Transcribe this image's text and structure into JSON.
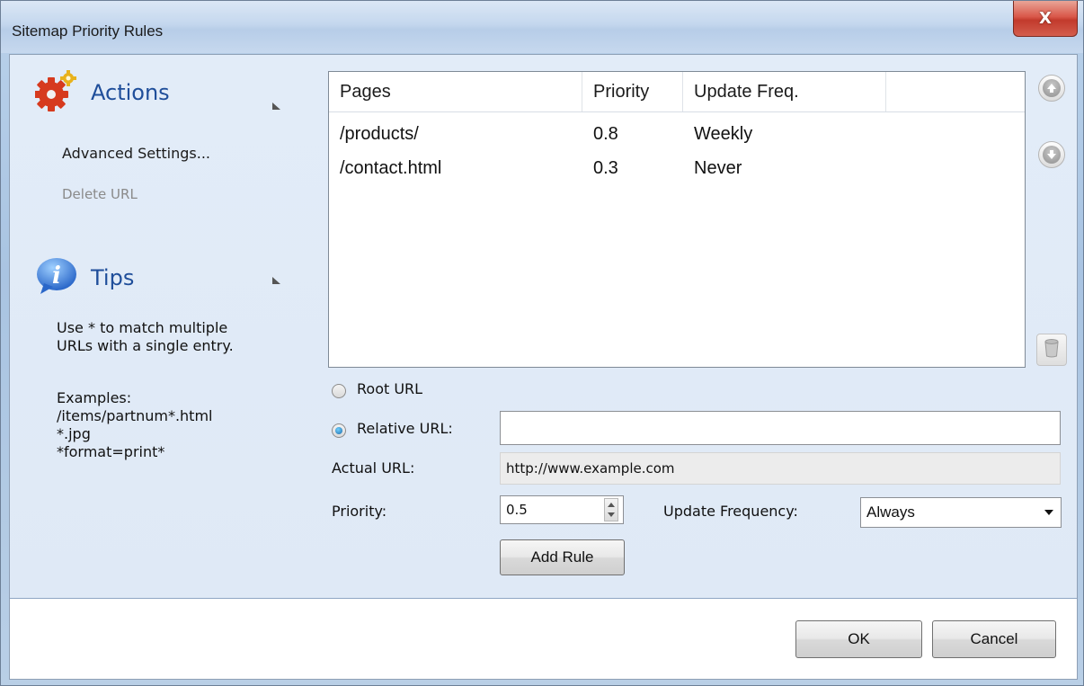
{
  "window": {
    "title": "Sitemap Priority Rules",
    "close_label": "X"
  },
  "sidebar": {
    "actions": {
      "title": "Actions",
      "items": [
        {
          "label": "Advanced Settings...",
          "enabled": true
        },
        {
          "label": "Delete URL",
          "enabled": false
        }
      ]
    },
    "tips": {
      "title": "Tips",
      "text": "Use * to match multiple\nURLs with a single entry.",
      "examples": "Examples:\n/items/partnum*.html\n*.jpg\n*format=print*"
    }
  },
  "rules_table": {
    "columns": [
      "Pages",
      "Priority",
      "Update Freq."
    ],
    "rows": [
      {
        "page": "/products/",
        "priority": "0.8",
        "freq": "Weekly"
      },
      {
        "page": "/contact.html",
        "priority": "0.3",
        "freq": "Never"
      }
    ]
  },
  "form": {
    "root_url_label": "Root URL",
    "relative_url_label": "Relative URL:",
    "relative_url_value": "",
    "selected_option": "Relative URL:",
    "actual_url_label": "Actual URL:",
    "actual_url_value": "http://www.example.com",
    "priority_label": "Priority:",
    "priority_value": "0.5",
    "update_freq_label": "Update Frequency:",
    "update_freq_value": "Always",
    "add_rule_label": "Add Rule"
  },
  "footer": {
    "ok_label": "OK",
    "cancel_label": "Cancel"
  },
  "colors": {
    "section_title": "#1f4e9a",
    "content_bg": "#e2ecf8",
    "close_button": "#c23a2c"
  }
}
